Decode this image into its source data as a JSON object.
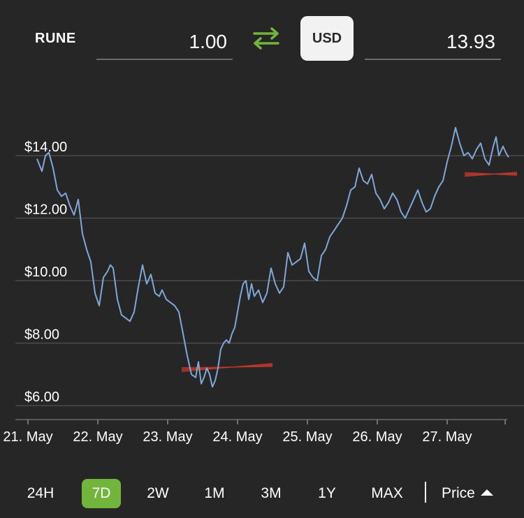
{
  "converter": {
    "coin": "RUNE",
    "coin_amount": "1.00",
    "currency": "USD",
    "currency_amount": "13.93",
    "swap_icon": "swap-arrows-icon",
    "colors": {
      "swap_icon": "#72b53c",
      "currency_button_bg": "#f2f2f2"
    }
  },
  "chart_data": {
    "type": "line",
    "y_tick_labels": [
      "$14.00",
      "$12.00",
      "$10.00",
      "$8.00",
      "$6.00"
    ],
    "y_ticks": [
      14,
      12,
      10,
      8,
      6
    ],
    "x_tick_labels": [
      "21. May",
      "22. May",
      "23. May",
      "24. May",
      "25. May",
      "26. May",
      "27. May"
    ],
    "ylim": [
      5.8,
      15.0
    ],
    "xlim": [
      21.15,
      28.0
    ],
    "grid": true,
    "line_color": "#7fa8d9",
    "series": [
      {
        "x": [
          21.13,
          21.2,
          21.25,
          21.3,
          21.36,
          21.42,
          21.48,
          21.54,
          21.6,
          21.66,
          21.72,
          21.78,
          21.84,
          21.9,
          21.96,
          22.02,
          22.08,
          22.14,
          22.18,
          22.22,
          22.28,
          22.34,
          22.4,
          22.46,
          22.52,
          22.58,
          22.64,
          22.7,
          22.76,
          22.82,
          22.88,
          22.92,
          22.98,
          23.04,
          23.1,
          23.16,
          23.22,
          23.28,
          23.34,
          23.4,
          23.44,
          23.48,
          23.52,
          23.56,
          23.6,
          23.64,
          23.68,
          23.72,
          23.76,
          23.8,
          23.84,
          23.88,
          23.92,
          23.96,
          24.0,
          24.04,
          24.08,
          24.12,
          24.16,
          24.2,
          24.24,
          24.3,
          24.36,
          24.42,
          24.48,
          24.54,
          24.6,
          24.66,
          24.72,
          24.78,
          24.84,
          24.9,
          24.96,
          25.02,
          25.08,
          25.14,
          25.2,
          25.26,
          25.32,
          25.38,
          25.44,
          25.5,
          25.56,
          25.62,
          25.68,
          25.74,
          25.8,
          25.86,
          25.92,
          25.98,
          26.04,
          26.1,
          26.16,
          26.22,
          26.28,
          26.34,
          26.4,
          26.46,
          26.52,
          26.58,
          26.64,
          26.7,
          26.76,
          26.82,
          26.88,
          26.94,
          27.0,
          27.06,
          27.12,
          27.18,
          27.24,
          27.3,
          27.36,
          27.42,
          27.48,
          27.54,
          27.6,
          27.66,
          27.7,
          27.74,
          27.8,
          27.84,
          27.88
        ],
        "y": [
          13.9,
          13.5,
          14.0,
          14.1,
          13.6,
          12.9,
          12.7,
          12.8,
          12.4,
          12.1,
          12.6,
          11.5,
          11.0,
          10.6,
          9.6,
          9.2,
          10.1,
          10.3,
          10.5,
          10.4,
          9.4,
          8.9,
          8.8,
          8.7,
          9.0,
          9.8,
          10.5,
          9.9,
          10.2,
          9.6,
          9.5,
          9.7,
          9.4,
          9.3,
          9.2,
          9.0,
          8.3,
          7.6,
          7.0,
          6.9,
          7.4,
          6.7,
          6.9,
          7.2,
          7.0,
          6.6,
          6.8,
          7.2,
          7.8,
          8.0,
          8.1,
          8.0,
          8.3,
          8.5,
          9.0,
          9.5,
          9.9,
          10.0,
          9.4,
          9.9,
          9.5,
          9.7,
          9.3,
          9.6,
          10.4,
          9.9,
          9.6,
          9.8,
          10.9,
          10.5,
          10.6,
          10.7,
          11.2,
          10.3,
          10.1,
          10.0,
          10.8,
          11.0,
          11.4,
          11.6,
          11.8,
          12.0,
          12.4,
          12.9,
          13.0,
          13.6,
          13.2,
          13.1,
          13.4,
          12.8,
          12.6,
          12.3,
          12.5,
          12.8,
          12.6,
          12.2,
          12.0,
          12.3,
          12.6,
          12.9,
          12.5,
          12.2,
          12.3,
          12.7,
          13.0,
          13.2,
          13.8,
          14.3,
          14.9,
          14.4,
          14.0,
          14.1,
          13.9,
          14.2,
          14.4,
          13.9,
          13.7,
          14.3,
          14.6,
          14.0,
          14.3,
          14.1,
          13.95
        ]
      }
    ],
    "annotations": [
      {
        "type": "red-marker-line",
        "x": [
          23.2,
          24.5
        ],
        "y": [
          7.15,
          7.3
        ]
      },
      {
        "type": "red-marker-line",
        "x": [
          27.25,
          28.0
        ],
        "y": [
          13.4,
          13.42
        ]
      }
    ]
  },
  "range_selector": {
    "buttons": [
      "24H",
      "7D",
      "2W",
      "1M",
      "3M",
      "1Y",
      "MAX"
    ],
    "active": "7D",
    "active_color": "#72b53c",
    "price_toggle": "Price",
    "price_toggle_icon": "caret-up-icon"
  }
}
